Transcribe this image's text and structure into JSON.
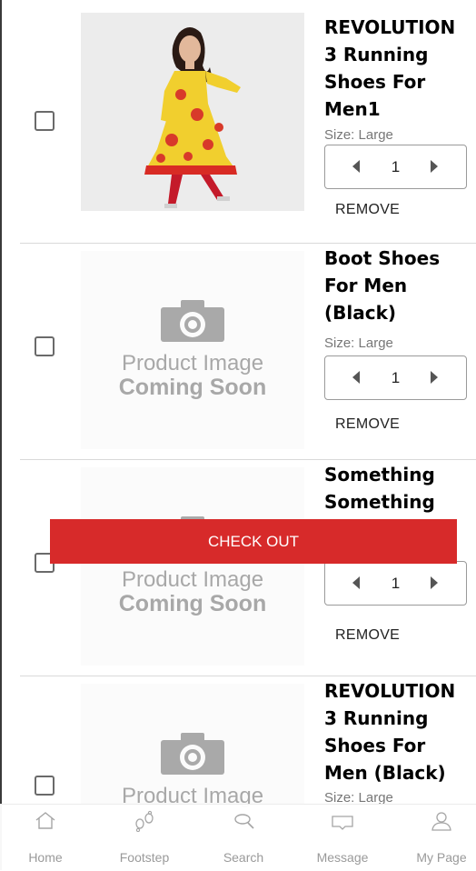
{
  "cart": {
    "items": [
      {
        "name_lines": [
          "REVOLUTION",
          "3 Running",
          "Shoes For",
          "Men1"
        ],
        "size": "Size: Large",
        "qty": "1",
        "remove_label": "REMOVE",
        "image": "yellow-floral-kurta-photo"
      },
      {
        "name_lines": [
          "Boot Shoes",
          "For Men",
          "(Black)"
        ],
        "size": "Size: Large",
        "qty": "1",
        "remove_label": "REMOVE",
        "image": "product-image-coming-soon",
        "placeholder_text": [
          "Product Image",
          "Coming Soon"
        ]
      },
      {
        "name_lines": [
          "Something",
          "Something"
        ],
        "qty": "1",
        "remove_label": "REMOVE",
        "image": "product-image-coming-soon",
        "placeholder_text": [
          "Product Image",
          "Coming Soon"
        ]
      },
      {
        "name_lines": [
          "REVOLUTION",
          "3 Running",
          "Shoes For",
          "Men (Black)"
        ],
        "size": "Size: Large",
        "image": "product-image-coming-soon",
        "placeholder_text": [
          "Product Image"
        ]
      }
    ],
    "checkout_label": "CHECK OUT"
  },
  "nav": {
    "items": [
      {
        "label": "Home",
        "icon": "home-icon"
      },
      {
        "label": "Footstep",
        "icon": "footstep-icon"
      },
      {
        "label": "Search",
        "icon": "search-icon"
      },
      {
        "label": "Message",
        "icon": "message-icon"
      },
      {
        "label": "My Page",
        "icon": "user-icon"
      }
    ]
  },
  "colors": {
    "accent": "#d72a2a",
    "muted": "#9a9a9a"
  }
}
